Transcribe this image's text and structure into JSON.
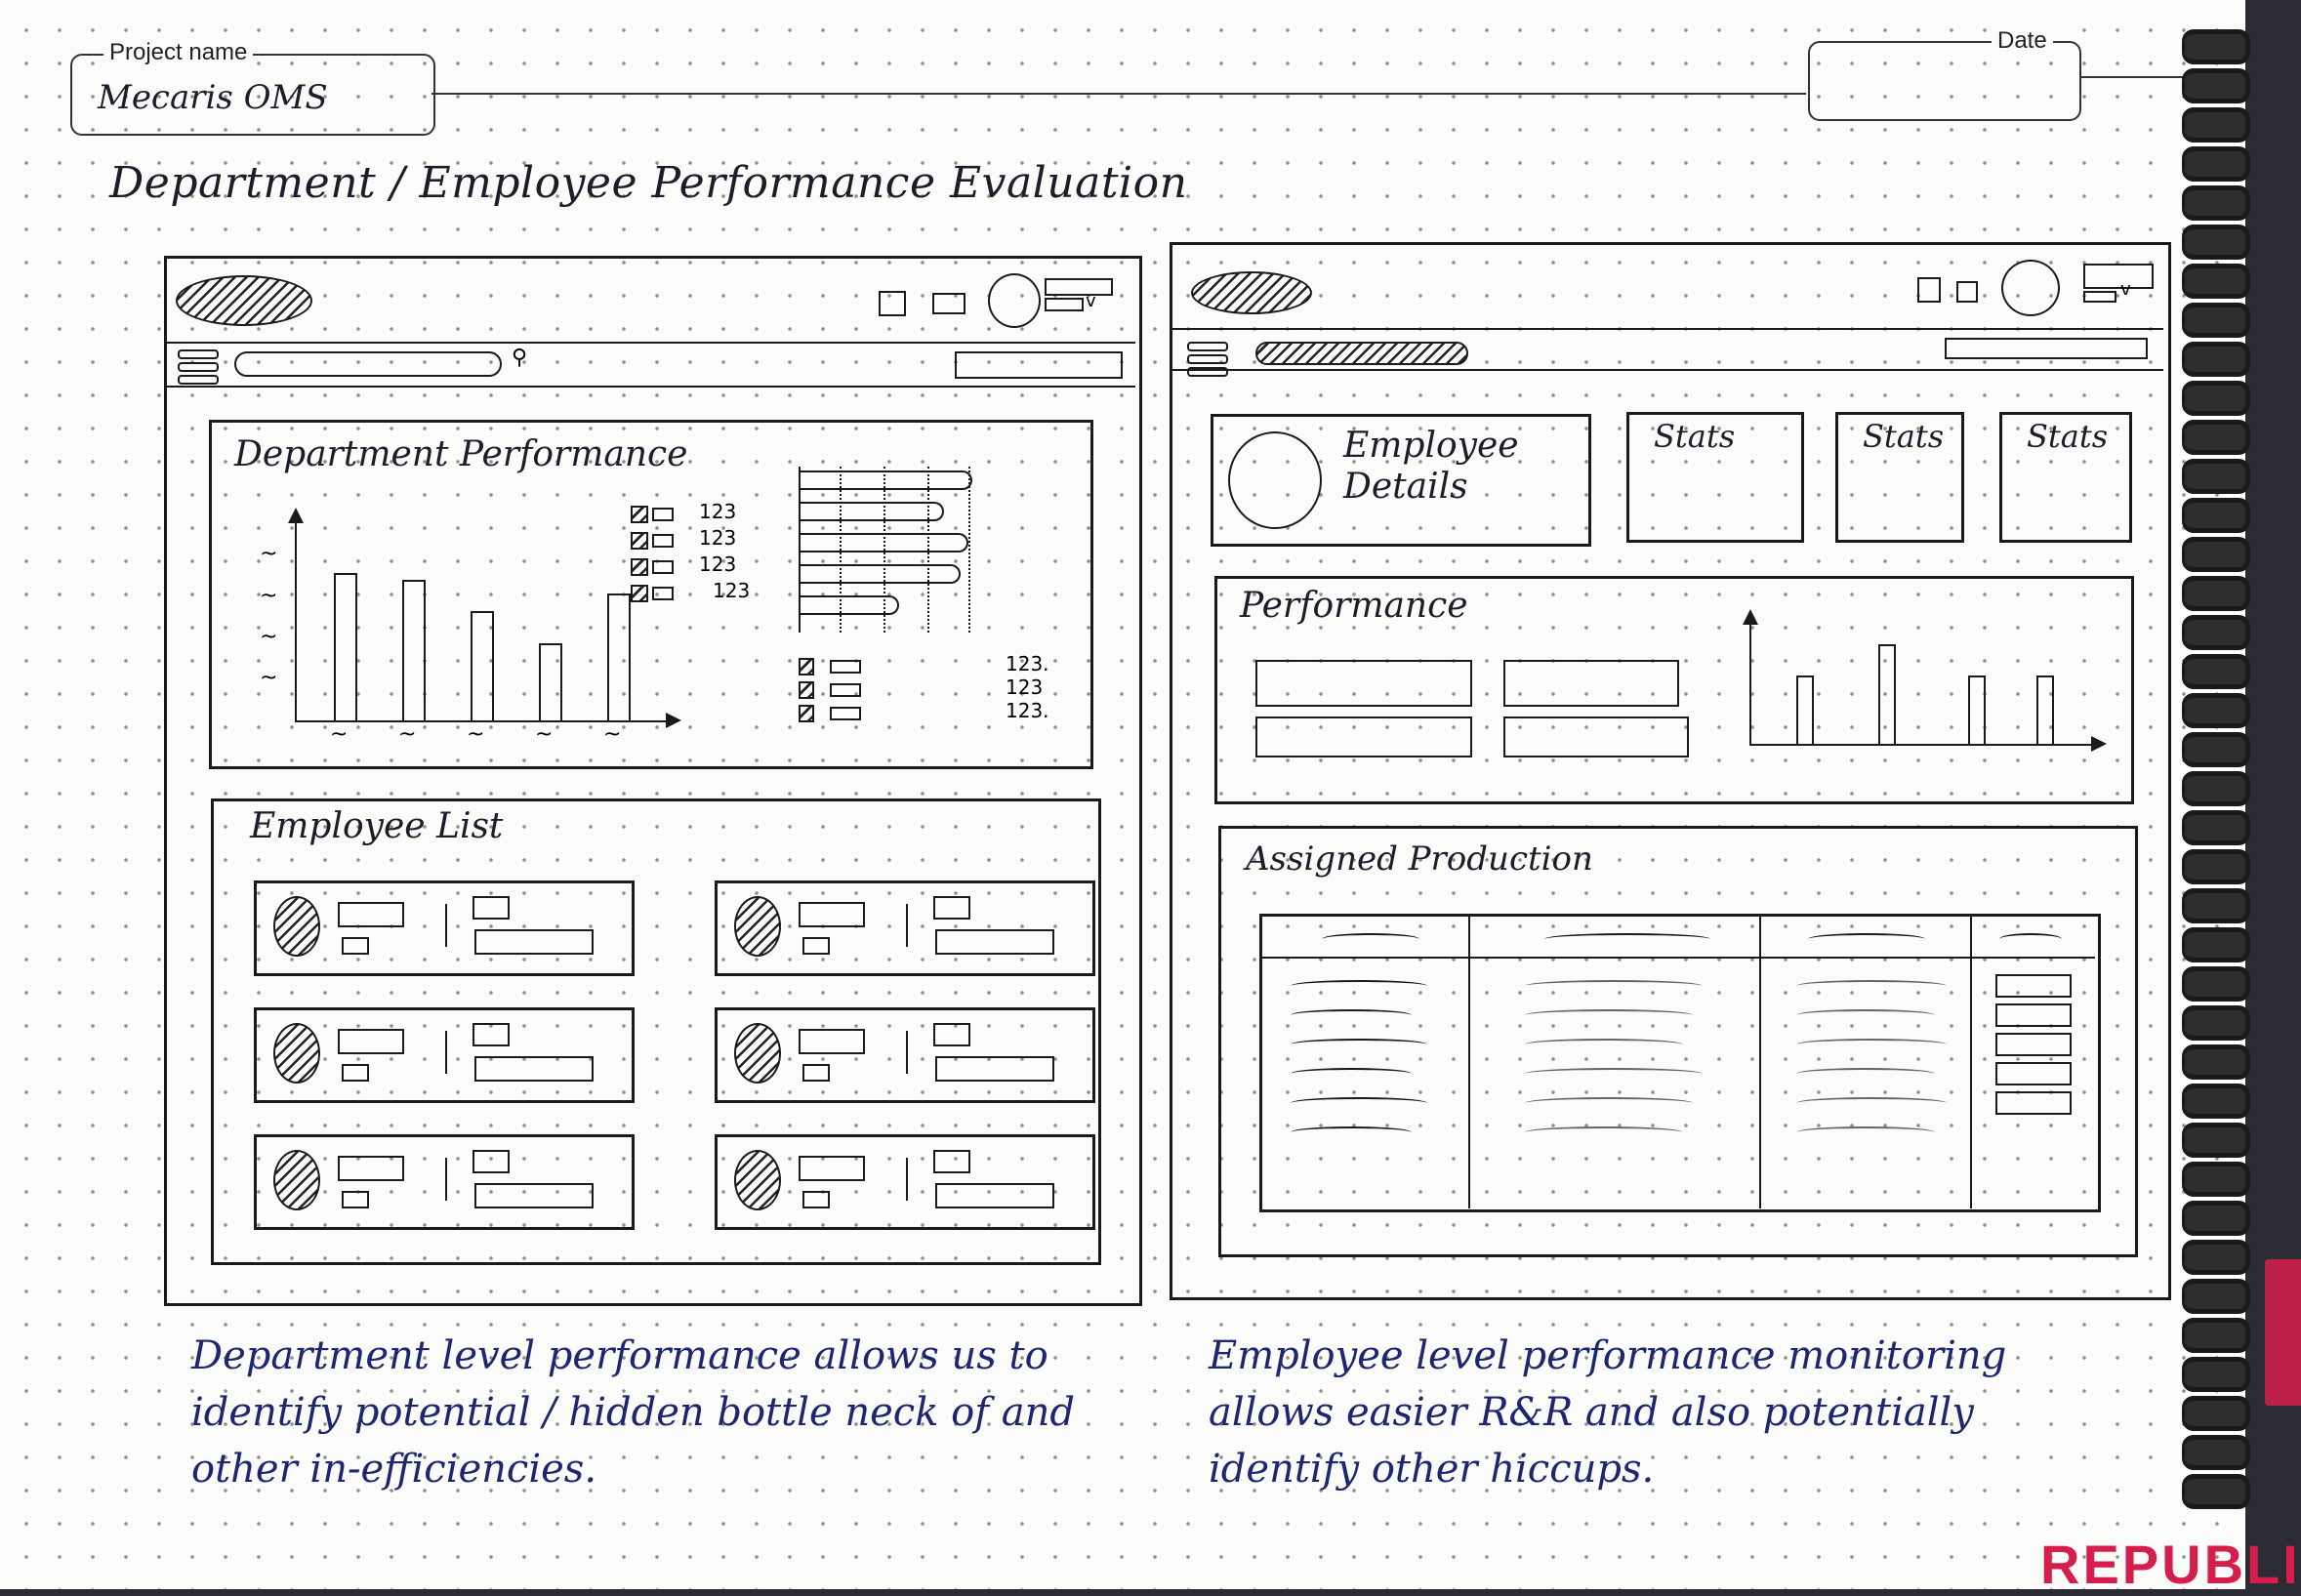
{
  "header": {
    "project_label": "Project name",
    "project_value": "Mecaris OMS",
    "date_label": "Date",
    "date_value": ""
  },
  "page_title": "Department / Employee Performance Evaluation",
  "left_screen": {
    "dept_performance": {
      "title": "Department Performance",
      "legend_values": [
        "123",
        "123",
        "123",
        "123"
      ],
      "legend2_values": [
        "123.",
        "123",
        "123."
      ]
    },
    "employee_list": {
      "title": "Employee List"
    }
  },
  "right_screen": {
    "employee_details": "Employee Details",
    "stats": [
      "Stats",
      "Stats",
      "Stats"
    ],
    "performance_title": "Performance",
    "assigned_title": "Assigned Production"
  },
  "notes": {
    "left": "Department level performance allows us to identify potential / hidden bottle neck of and other in-efficiencies.",
    "right": "Employee level performance monitoring allows easier R&R and also potentially identify other hiccups."
  },
  "brand_text": "REPUBLI",
  "colors": {
    "ink": "#1a1a1a",
    "blue_ink": "#1d2670",
    "paper": "#fbfbfa",
    "accent": "#d61e4c"
  },
  "chart_data": [
    {
      "type": "bar",
      "title": "",
      "categories": [
        "~",
        "~",
        "~",
        "~",
        "~"
      ],
      "values": [
        4.2,
        4.0,
        3.1,
        2.2,
        3.6
      ],
      "ylim": [
        0,
        5
      ]
    },
    {
      "type": "bar",
      "title": "",
      "orientation": "horizontal",
      "categories": [
        "",
        "",
        "",
        "",
        ""
      ],
      "values": [
        4.2,
        3.5,
        4.1,
        3.9,
        2.4
      ],
      "xlim": [
        0,
        5
      ]
    },
    {
      "type": "bar",
      "title": "",
      "categories": [
        "",
        "",
        "",
        ""
      ],
      "values": [
        2.2,
        3.2,
        2.2,
        2.2
      ],
      "ylim": [
        0,
        4
      ]
    }
  ]
}
